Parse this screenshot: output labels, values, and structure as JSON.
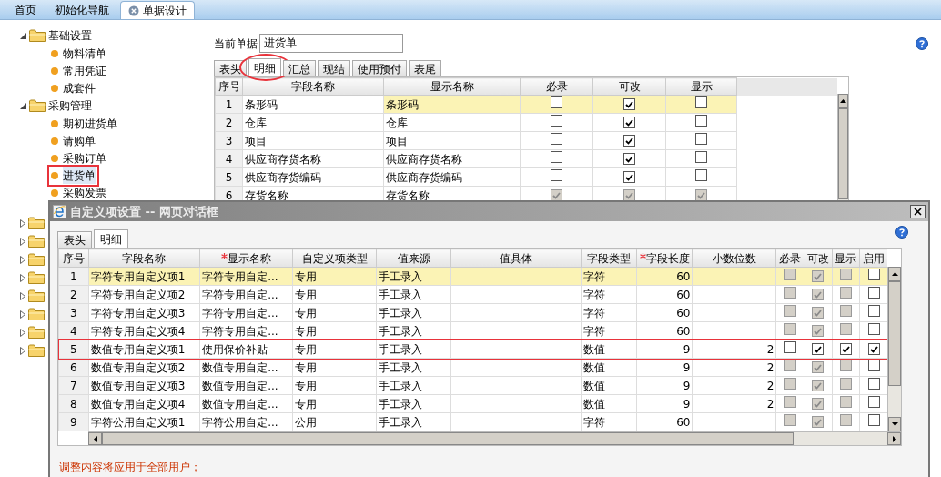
{
  "top_tabs": [
    {
      "label": "首页",
      "selected": false,
      "closable": false
    },
    {
      "label": "初始化导航",
      "selected": false,
      "closable": false
    },
    {
      "label": "单据设计",
      "selected": true,
      "closable": true
    }
  ],
  "tree": [
    {
      "label": "基础设置",
      "expanded": true,
      "children": [
        {
          "label": "物料清单",
          "selected": false,
          "boxed": false
        },
        {
          "label": "常用凭证",
          "selected": false,
          "boxed": false
        },
        {
          "label": "成套件",
          "selected": false,
          "boxed": false
        }
      ]
    },
    {
      "label": "采购管理",
      "expanded": true,
      "children": [
        {
          "label": "期初进货单",
          "selected": false,
          "boxed": false
        },
        {
          "label": "请购单",
          "selected": false,
          "boxed": false
        },
        {
          "label": "采购订单",
          "selected": false,
          "boxed": false
        },
        {
          "label": "进货单",
          "selected": true,
          "boxed": true
        },
        {
          "label": "采购发票",
          "selected": false,
          "boxed": false
        }
      ]
    },
    {
      "expanded": false
    },
    {
      "expanded": false
    },
    {
      "expanded": false
    },
    {
      "expanded": false
    },
    {
      "expanded": false
    },
    {
      "expanded": false
    },
    {
      "expanded": false
    },
    {
      "expanded": false
    }
  ],
  "current_doc": {
    "label": "当前单据",
    "value": "进货单"
  },
  "doc_tabs": [
    {
      "label": "表头",
      "selected": false,
      "circled": false
    },
    {
      "label": "明细",
      "selected": true,
      "circled": true
    },
    {
      "label": "汇总",
      "selected": false,
      "circled": false
    },
    {
      "label": "现结",
      "selected": false,
      "circled": false
    },
    {
      "label": "使用预付",
      "selected": false,
      "circled": false
    },
    {
      "label": "表尾",
      "selected": false,
      "circled": false
    }
  ],
  "doc_table": {
    "columns": [
      "序号",
      "字段名称",
      "显示名称",
      "必录",
      "可改",
      "显示"
    ],
    "rows": [
      {
        "no": "1",
        "field": "条形码",
        "display": "条形码",
        "selected": true,
        "flags": [
          {
            "checked": false,
            "disabled": false
          },
          {
            "checked": true,
            "disabled": false
          },
          {
            "checked": false,
            "disabled": false
          }
        ]
      },
      {
        "no": "2",
        "field": "仓库",
        "display": "仓库",
        "selected": false,
        "flags": [
          {
            "checked": false,
            "disabled": false
          },
          {
            "checked": true,
            "disabled": false
          },
          {
            "checked": false,
            "disabled": false
          }
        ]
      },
      {
        "no": "3",
        "field": "项目",
        "display": "项目",
        "selected": false,
        "flags": [
          {
            "checked": false,
            "disabled": false
          },
          {
            "checked": true,
            "disabled": false
          },
          {
            "checked": false,
            "disabled": false
          }
        ]
      },
      {
        "no": "4",
        "field": "供应商存货名称",
        "display": "供应商存货名称",
        "selected": false,
        "flags": [
          {
            "checked": false,
            "disabled": false
          },
          {
            "checked": true,
            "disabled": false
          },
          {
            "checked": false,
            "disabled": false
          }
        ]
      },
      {
        "no": "5",
        "field": "供应商存货编码",
        "display": "供应商存货编码",
        "selected": false,
        "flags": [
          {
            "checked": false,
            "disabled": false
          },
          {
            "checked": true,
            "disabled": false
          },
          {
            "checked": false,
            "disabled": false
          }
        ]
      },
      {
        "no": "6",
        "field": "存货名称",
        "display": "存货名称",
        "selected": false,
        "flags": [
          {
            "checked": true,
            "disabled": true
          },
          {
            "checked": true,
            "disabled": true
          },
          {
            "checked": true,
            "disabled": true
          }
        ]
      }
    ]
  },
  "dialog": {
    "title": "自定义项设置 -- 网页对话框",
    "tabs": [
      {
        "label": "表头",
        "selected": false
      },
      {
        "label": "明细",
        "selected": true
      }
    ],
    "columns": [
      {
        "label": "序号",
        "required": false
      },
      {
        "label": "字段名称",
        "required": false
      },
      {
        "label": "显示名称",
        "required": true
      },
      {
        "label": "自定义项类型",
        "required": false
      },
      {
        "label": "值来源",
        "required": false
      },
      {
        "label": "值具体",
        "required": false
      },
      {
        "label": "字段类型",
        "required": false
      },
      {
        "label": "字段长度",
        "required": true
      },
      {
        "label": "小数位数",
        "required": false
      },
      {
        "label": "必录",
        "required": false
      },
      {
        "label": "可改",
        "required": false
      },
      {
        "label": "显示",
        "required": false
      },
      {
        "label": "启用",
        "required": false
      }
    ],
    "rows": [
      {
        "no": "1",
        "field": "字符专用自定义项1",
        "display": "字符专用自定...",
        "type": "专用",
        "source": "手工录入",
        "field_type": "字符",
        "length": "60",
        "selected": true,
        "boxed": false,
        "flags": [
          {
            "checked": false,
            "disabled": true
          },
          {
            "checked": true,
            "disabled": true
          },
          {
            "checked": false,
            "disabled": true
          },
          {
            "checked": false,
            "disabled": false
          }
        ]
      },
      {
        "no": "2",
        "field": "字符专用自定义项2",
        "display": "字符专用自定...",
        "type": "专用",
        "source": "手工录入",
        "field_type": "字符",
        "length": "60",
        "selected": false,
        "boxed": false,
        "flags": [
          {
            "checked": false,
            "disabled": true
          },
          {
            "checked": true,
            "disabled": true
          },
          {
            "checked": false,
            "disabled": true
          },
          {
            "checked": false,
            "disabled": false
          }
        ]
      },
      {
        "no": "3",
        "field": "字符专用自定义项3",
        "display": "字符专用自定...",
        "type": "专用",
        "source": "手工录入",
        "field_type": "字符",
        "length": "60",
        "selected": false,
        "boxed": false,
        "flags": [
          {
            "checked": false,
            "disabled": true
          },
          {
            "checked": true,
            "disabled": true
          },
          {
            "checked": false,
            "disabled": true
          },
          {
            "checked": false,
            "disabled": false
          }
        ]
      },
      {
        "no": "4",
        "field": "字符专用自定义项4",
        "display": "字符专用自定...",
        "type": "专用",
        "source": "手工录入",
        "field_type": "字符",
        "length": "60",
        "selected": false,
        "boxed": false,
        "flags": [
          {
            "checked": false,
            "disabled": true
          },
          {
            "checked": true,
            "disabled": true
          },
          {
            "checked": false,
            "disabled": true
          },
          {
            "checked": false,
            "disabled": false
          }
        ]
      },
      {
        "no": "5",
        "field": "数值专用自定义项1",
        "display": "使用保价补贴",
        "type": "专用",
        "source": "手工录入",
        "field_type": "数值",
        "length": "9",
        "decimals": "2",
        "selected": false,
        "boxed": true,
        "flags": [
          {
            "checked": false,
            "disabled": false
          },
          {
            "checked": true,
            "disabled": false
          },
          {
            "checked": true,
            "disabled": false
          },
          {
            "checked": true,
            "disabled": false
          }
        ]
      },
      {
        "no": "6",
        "field": "数值专用自定义项2",
        "display": "数值专用自定...",
        "type": "专用",
        "source": "手工录入",
        "field_type": "数值",
        "length": "9",
        "decimals": "2",
        "selected": false,
        "boxed": false,
        "flags": [
          {
            "checked": false,
            "disabled": true
          },
          {
            "checked": true,
            "disabled": true
          },
          {
            "checked": false,
            "disabled": true
          },
          {
            "checked": false,
            "disabled": false
          }
        ]
      },
      {
        "no": "7",
        "field": "数值专用自定义项3",
        "display": "数值专用自定...",
        "type": "专用",
        "source": "手工录入",
        "field_type": "数值",
        "length": "9",
        "decimals": "2",
        "selected": false,
        "boxed": false,
        "flags": [
          {
            "checked": false,
            "disabled": true
          },
          {
            "checked": true,
            "disabled": true
          },
          {
            "checked": false,
            "disabled": true
          },
          {
            "checked": false,
            "disabled": false
          }
        ]
      },
      {
        "no": "8",
        "field": "数值专用自定义项4",
        "display": "数值专用自定...",
        "type": "专用",
        "source": "手工录入",
        "field_type": "数值",
        "length": "9",
        "decimals": "2",
        "selected": false,
        "boxed": false,
        "flags": [
          {
            "checked": false,
            "disabled": true
          },
          {
            "checked": true,
            "disabled": true
          },
          {
            "checked": false,
            "disabled": true
          },
          {
            "checked": false,
            "disabled": false
          }
        ]
      },
      {
        "no": "9",
        "field": "字符公用自定义项1",
        "display": "字符公用自定...",
        "type": "公用",
        "source": "手工录入",
        "field_type": "字符",
        "length": "60",
        "selected": false,
        "boxed": false,
        "flags": [
          {
            "checked": false,
            "disabled": true
          },
          {
            "checked": true,
            "disabled": true
          },
          {
            "checked": false,
            "disabled": true
          },
          {
            "checked": false,
            "disabled": false
          }
        ]
      }
    ],
    "notice": "调整内容将应用于全部用户；"
  }
}
